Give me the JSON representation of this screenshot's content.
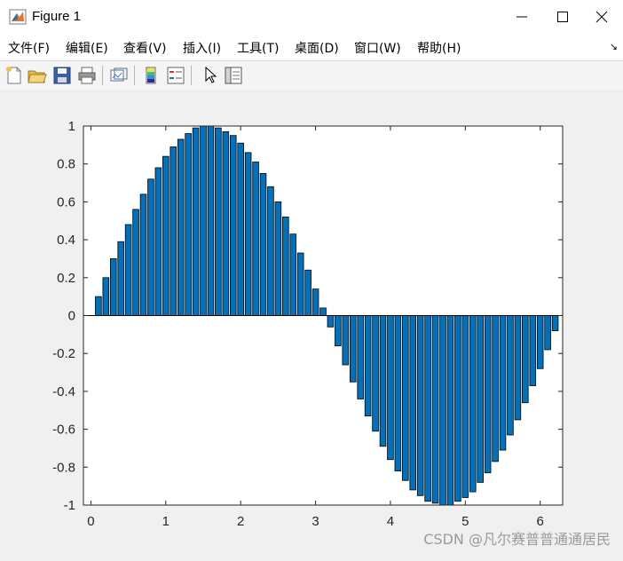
{
  "window": {
    "title": "Figure 1"
  },
  "menu": [
    "文件(F)",
    "编辑(E)",
    "查看(V)",
    "插入(I)",
    "工具(T)",
    "桌面(D)",
    "窗口(W)",
    "帮助(H)"
  ],
  "toolbar": {
    "icons": [
      "new-figure-icon",
      "open-file-icon",
      "save-icon",
      "print-icon",
      "link-plot-icon",
      "insert-colorbar-icon",
      "insert-legend-icon",
      "edit-plot-pointer-icon",
      "property-inspector-icon"
    ]
  },
  "colors": {
    "bar_fill": "#0072bd",
    "bar_edge": "#000000"
  },
  "watermark": "CSDN @凡尔赛普普通通居民",
  "chart_data": {
    "type": "bar",
    "title": "",
    "xlabel": "",
    "ylabel": "",
    "xlim": [
      -0.1,
      6.3
    ],
    "ylim": [
      -1,
      1
    ],
    "xticks": [
      0,
      1,
      2,
      3,
      4,
      5,
      6
    ],
    "yticks": [
      -1,
      -0.8,
      -0.6,
      -0.4,
      -0.2,
      0,
      0.2,
      0.4,
      0.6,
      0.8,
      1
    ],
    "ytick_labels": [
      "-1",
      "-0.8",
      "-0.6",
      "-0.4",
      "-0.2",
      "0",
      "0.2",
      "0.4",
      "0.6",
      "0.8",
      "1"
    ],
    "x": [
      0.1,
      0.2,
      0.3,
      0.4,
      0.5,
      0.6,
      0.7,
      0.8,
      0.9,
      1.0,
      1.1,
      1.2,
      1.3,
      1.4,
      1.5,
      1.6,
      1.7,
      1.8,
      1.9,
      2.0,
      2.1,
      2.2,
      2.3,
      2.4,
      2.5,
      2.6,
      2.7,
      2.8,
      2.9,
      3.0,
      3.1,
      3.2,
      3.3,
      3.4,
      3.5,
      3.6,
      3.7,
      3.8,
      3.9,
      4.0,
      4.1,
      4.2,
      4.3,
      4.4,
      4.5,
      4.6,
      4.7,
      4.8,
      4.9,
      5.0,
      5.1,
      5.2,
      5.3,
      5.4,
      5.5,
      5.6,
      5.7,
      5.8,
      5.9,
      6.0,
      6.1,
      6.2
    ],
    "values": [
      0.1,
      0.2,
      0.3,
      0.39,
      0.48,
      0.56,
      0.64,
      0.72,
      0.78,
      0.84,
      0.89,
      0.93,
      0.96,
      0.99,
      1.0,
      1.0,
      0.99,
      0.97,
      0.95,
      0.91,
      0.86,
      0.81,
      0.75,
      0.68,
      0.6,
      0.52,
      0.43,
      0.33,
      0.24,
      0.14,
      0.04,
      -0.06,
      -0.16,
      -0.26,
      -0.35,
      -0.44,
      -0.53,
      -0.61,
      -0.69,
      -0.76,
      -0.82,
      -0.87,
      -0.92,
      -0.95,
      -0.98,
      -0.99,
      -1.0,
      -1.0,
      -0.98,
      -0.96,
      -0.93,
      -0.88,
      -0.83,
      -0.77,
      -0.71,
      -0.63,
      -0.55,
      -0.46,
      -0.37,
      -0.28,
      -0.18,
      -0.08
    ],
    "grid": false,
    "legend": "none"
  }
}
